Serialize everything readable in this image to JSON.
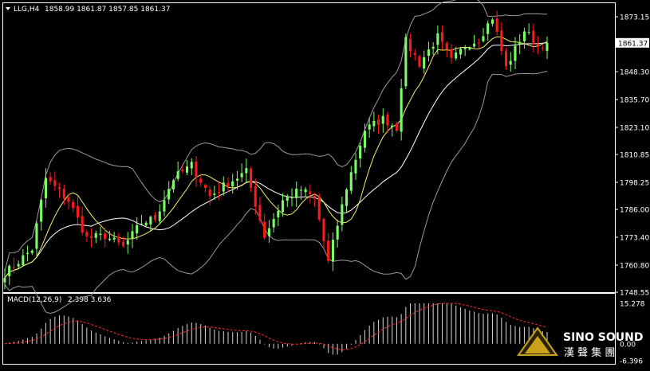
{
  "header": {
    "symbol_text": "LLG,H4",
    "ohlc_text": "1858.99 1861.87 1857.85 1861.37"
  },
  "macd_header": {
    "label_text": "MACD(12,26,9)",
    "values_text": "2.398 3.636"
  },
  "logo": {
    "english": "SINO SOUND",
    "chinese": "漢 聲 集 團"
  },
  "colors": {
    "background": "#000000",
    "bull": "#7cfc66",
    "bear": "#ff1a1a",
    "ma": "#f4f06a",
    "band": "#9a9a9a",
    "text": "#ffffff",
    "macd_hist": "#d8d8d8",
    "macd_signal": "#ff2b2b",
    "price_tag_bg": "#ffffff",
    "price_tag_text": "#000000"
  },
  "chart_data": [
    {
      "type": "candlestick",
      "title": "LLG,H4",
      "ylim": [
        1748.55,
        1879.3
      ],
      "yticks": [
        "1873.15",
        "1861.37",
        "1848.30",
        "1835.70",
        "1823.10",
        "1810.85",
        "1798.25",
        "1786.00",
        "1773.40",
        "1760.80",
        "1748.55"
      ],
      "last_price": "1861.37",
      "grid": false,
      "indicators": [
        "Bollinger Bands",
        "Moving Average"
      ],
      "key_points": [
        {
          "bar": 0,
          "close": 1757
        },
        {
          "bar": 6,
          "close": 1768
        },
        {
          "bar": 9,
          "close": 1800
        },
        {
          "bar": 14,
          "close": 1790
        },
        {
          "bar": 18,
          "close": 1773
        },
        {
          "bar": 22,
          "close": 1774
        },
        {
          "bar": 26,
          "close": 1769
        },
        {
          "bar": 30,
          "close": 1780
        },
        {
          "bar": 33,
          "close": 1782
        },
        {
          "bar": 37,
          "close": 1800
        },
        {
          "bar": 41,
          "close": 1806
        },
        {
          "bar": 45,
          "close": 1792
        },
        {
          "bar": 49,
          "close": 1798
        },
        {
          "bar": 53,
          "close": 1803
        },
        {
          "bar": 57,
          "close": 1774
        },
        {
          "bar": 61,
          "close": 1790
        },
        {
          "bar": 65,
          "close": 1795
        },
        {
          "bar": 68,
          "close": 1791
        },
        {
          "bar": 71,
          "close": 1762
        },
        {
          "bar": 75,
          "close": 1796
        },
        {
          "bar": 79,
          "close": 1822
        },
        {
          "bar": 83,
          "close": 1827
        },
        {
          "bar": 86,
          "close": 1823
        },
        {
          "bar": 88,
          "close": 1862
        },
        {
          "bar": 91,
          "close": 1852
        },
        {
          "bar": 95,
          "close": 1864
        },
        {
          "bar": 98,
          "close": 1853
        },
        {
          "bar": 101,
          "close": 1860
        },
        {
          "bar": 104,
          "close": 1863
        },
        {
          "bar": 107,
          "close": 1873
        },
        {
          "bar": 110,
          "close": 1850
        },
        {
          "bar": 114,
          "close": 1867
        },
        {
          "bar": 117,
          "close": 1860
        },
        {
          "bar": 119,
          "close": 1861.37
        }
      ]
    },
    {
      "type": "bar",
      "title": "MACD(12,26,9)",
      "ylim": [
        -6.396,
        15.278
      ],
      "yticks": [
        "15.278",
        "0.00",
        "-6.396"
      ],
      "signal_line": true
    }
  ]
}
